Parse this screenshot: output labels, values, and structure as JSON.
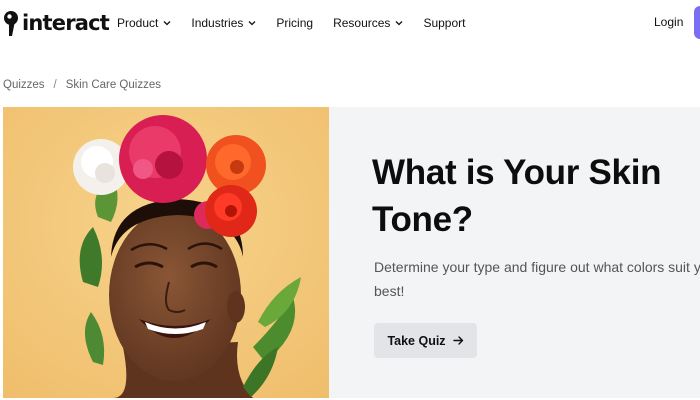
{
  "brand": {
    "name": "interact",
    "icon": "interact-logo-icon"
  },
  "nav": {
    "items": [
      {
        "label": "Product",
        "has_dropdown": true
      },
      {
        "label": "Industries",
        "has_dropdown": true
      },
      {
        "label": "Pricing",
        "has_dropdown": false
      },
      {
        "label": "Resources",
        "has_dropdown": true
      },
      {
        "label": "Support",
        "has_dropdown": false
      }
    ],
    "login": "Login"
  },
  "breadcrumb": {
    "items": [
      "Quizzes",
      "Skin Care Quizzes"
    ],
    "separator": "/"
  },
  "hero": {
    "title_line1": "What is Your Skin",
    "title_line2": "Tone?",
    "desc_line1": "Determine your type and figure out what colors suit y",
    "desc_line2": "best!",
    "button_label": "Take Quiz",
    "button_icon": "arrow-right-icon",
    "image": "smiling-woman-flower-crown-photo"
  },
  "colors": {
    "accent": "#7c6ef2",
    "hero_bg": "#f3f4f6",
    "image_bg": "#f3c77b",
    "button_bg": "#e3e4e8",
    "text": "#111111",
    "muted": "#555555"
  }
}
